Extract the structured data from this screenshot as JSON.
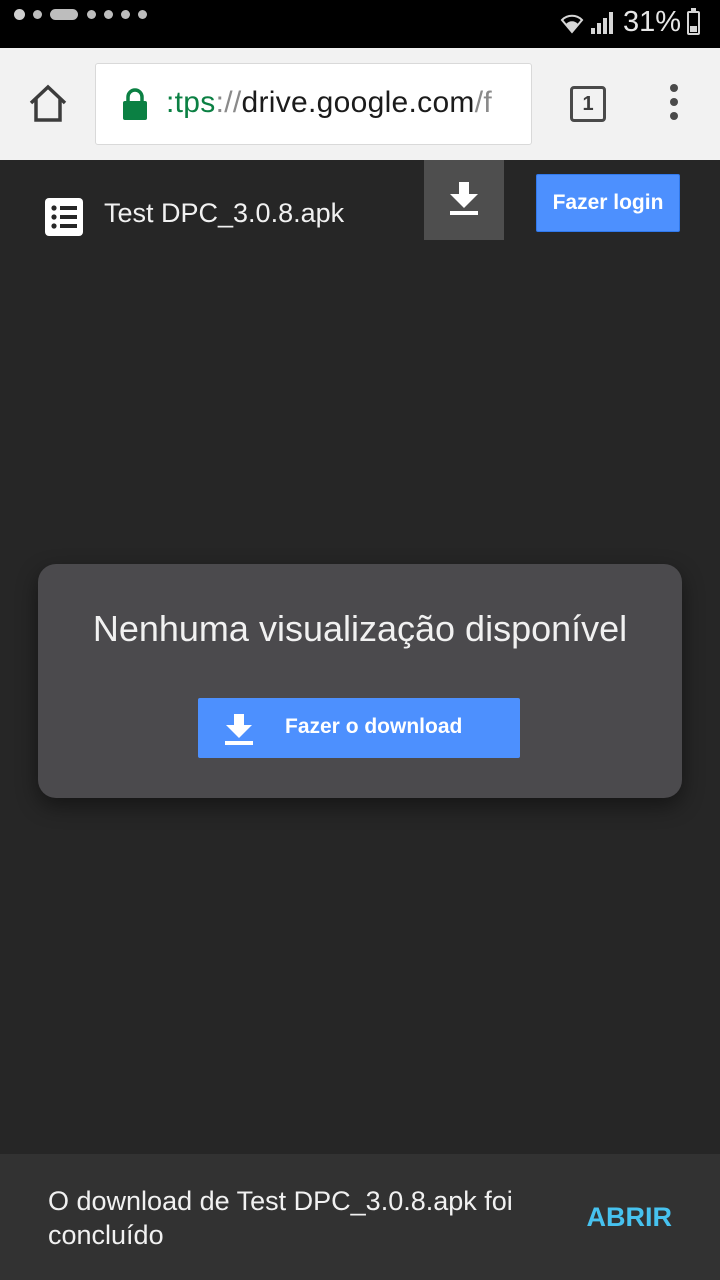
{
  "status_bar": {
    "battery": "31%",
    "icons": [
      "notification-dot-icon",
      "notification-pill-icon",
      "wifi-icon",
      "signal-icon",
      "battery-icon"
    ]
  },
  "browser": {
    "url_scheme": ":tps",
    "url_separator": "://",
    "url_host": "drive.google.com",
    "url_path": "/f",
    "tab_count": "1",
    "colors": {
      "secure": "#0b8043",
      "toolbar": "#f2f2f2"
    }
  },
  "drive": {
    "file_name": "Test DPC_3.0.8.apk",
    "login_label": "Fazer login",
    "preview_message": "Nenhuma visualização disponível",
    "download_label": "Fazer o download",
    "colors": {
      "button_blue": "#4d90fe",
      "card": "#4b4a4d",
      "background": "#262626"
    }
  },
  "snackbar": {
    "message": "O download de Test DPC_3.0.8.apk foi concluído",
    "action": "ABRIR",
    "action_color": "#47c2ef"
  }
}
